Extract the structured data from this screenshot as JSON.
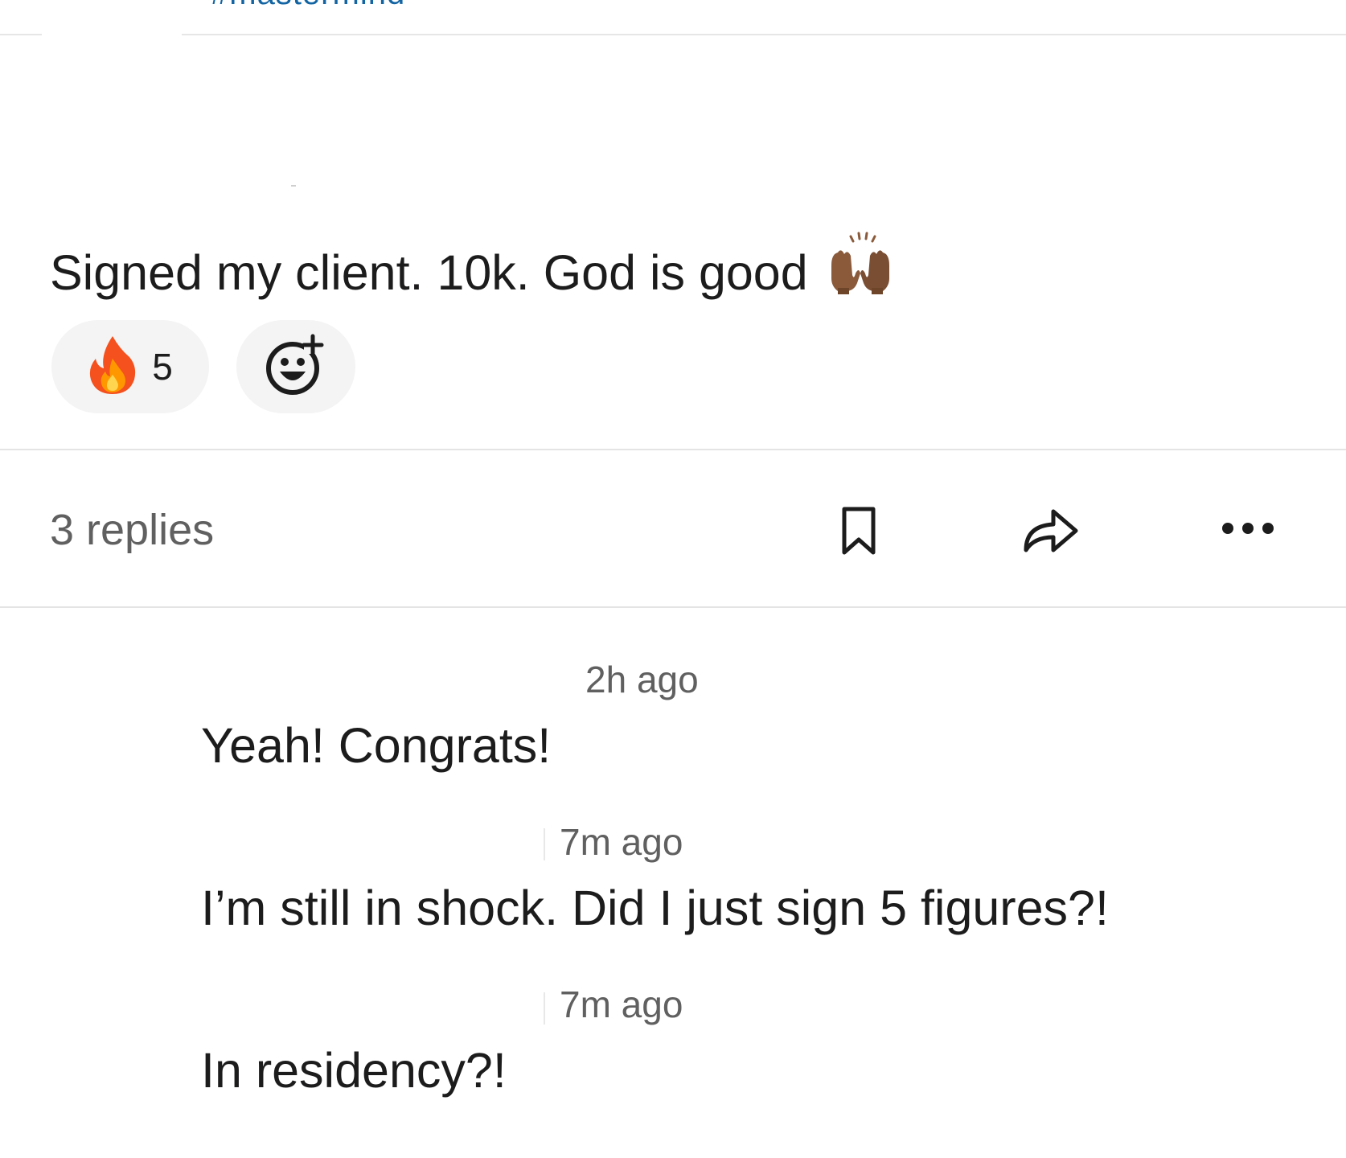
{
  "header": {
    "channel_name": "#mastermind"
  },
  "message": {
    "text": "Signed my client. 10k. God is good",
    "emoji": "raising-hands-icon",
    "reactions": [
      {
        "emoji": "fire-icon",
        "count": "5"
      }
    ],
    "add_reaction_icon": "add-reaction-icon"
  },
  "thread_bar": {
    "replies_label": "3 replies",
    "actions": [
      "bookmark-icon",
      "share-icon",
      "more-icon"
    ]
  },
  "replies": [
    {
      "timestamp": "2h ago",
      "text": "Yeah! Congrats!"
    },
    {
      "timestamp": "7m ago",
      "text": "I’m still in shock. Did I just sign 5 figures?!"
    },
    {
      "timestamp": "7m ago",
      "text": "In residency?!"
    }
  ],
  "colors": {
    "text": "#1d1c1d",
    "muted": "#616061",
    "pill_bg": "#f4f4f4",
    "divider": "#e4e4e4",
    "fire_orange": "#f4762a",
    "skin": "#8a5a3b"
  }
}
